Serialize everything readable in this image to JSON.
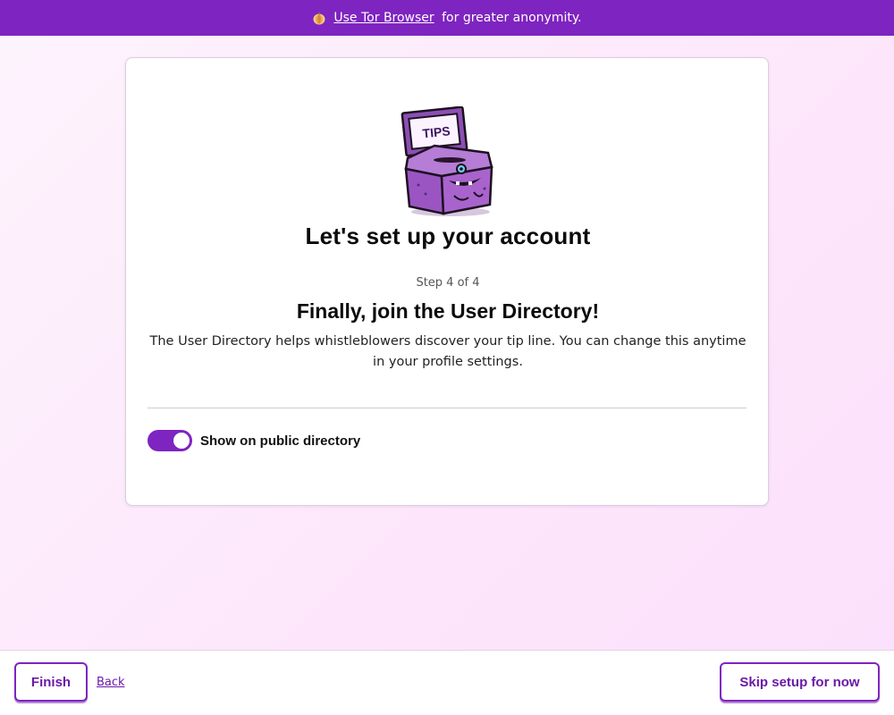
{
  "banner": {
    "link_text": "Use Tor Browser",
    "suffix_text": " for greater anonymity.",
    "icon": "onion-icon"
  },
  "card": {
    "illustration_label": "TIPS",
    "heading": "Let's set up your account",
    "step": "Step 4 of 4",
    "subheading": "Finally, join the User Directory!",
    "description": "The User Directory helps whistleblowers discover your tip line. You can change this anytime in your profile settings.",
    "toggle": {
      "label": "Show on public directory",
      "checked": true
    }
  },
  "footer": {
    "finish_label": "Finish",
    "back_label": "Back",
    "skip_label": "Skip setup for now"
  },
  "colors": {
    "accent": "#7e24c0",
    "accent_text": "#6a1aa8",
    "background": "#fde6fb"
  }
}
